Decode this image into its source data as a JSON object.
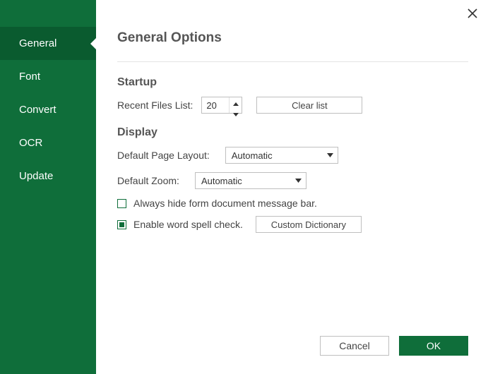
{
  "sidebar": {
    "items": [
      {
        "label": "General",
        "active": true
      },
      {
        "label": "Font",
        "active": false
      },
      {
        "label": "Convert",
        "active": false
      },
      {
        "label": "OCR",
        "active": false
      },
      {
        "label": "Update",
        "active": false
      }
    ]
  },
  "header": {
    "title": "General Options"
  },
  "startup": {
    "section_title": "Startup",
    "recent_label": "Recent Files List:",
    "recent_value": "20",
    "clear_label": "Clear list"
  },
  "display": {
    "section_title": "Display",
    "layout_label": "Default Page Layout:",
    "layout_value": "Automatic",
    "zoom_label": "Default Zoom:",
    "zoom_value": "Automatic",
    "hide_msgbar_label": "Always hide form document message bar.",
    "hide_msgbar_checked": false,
    "spellcheck_label": "Enable word spell check.",
    "spellcheck_checked": true,
    "custom_dict_label": "Custom Dictionary"
  },
  "footer": {
    "cancel": "Cancel",
    "ok": "OK"
  }
}
